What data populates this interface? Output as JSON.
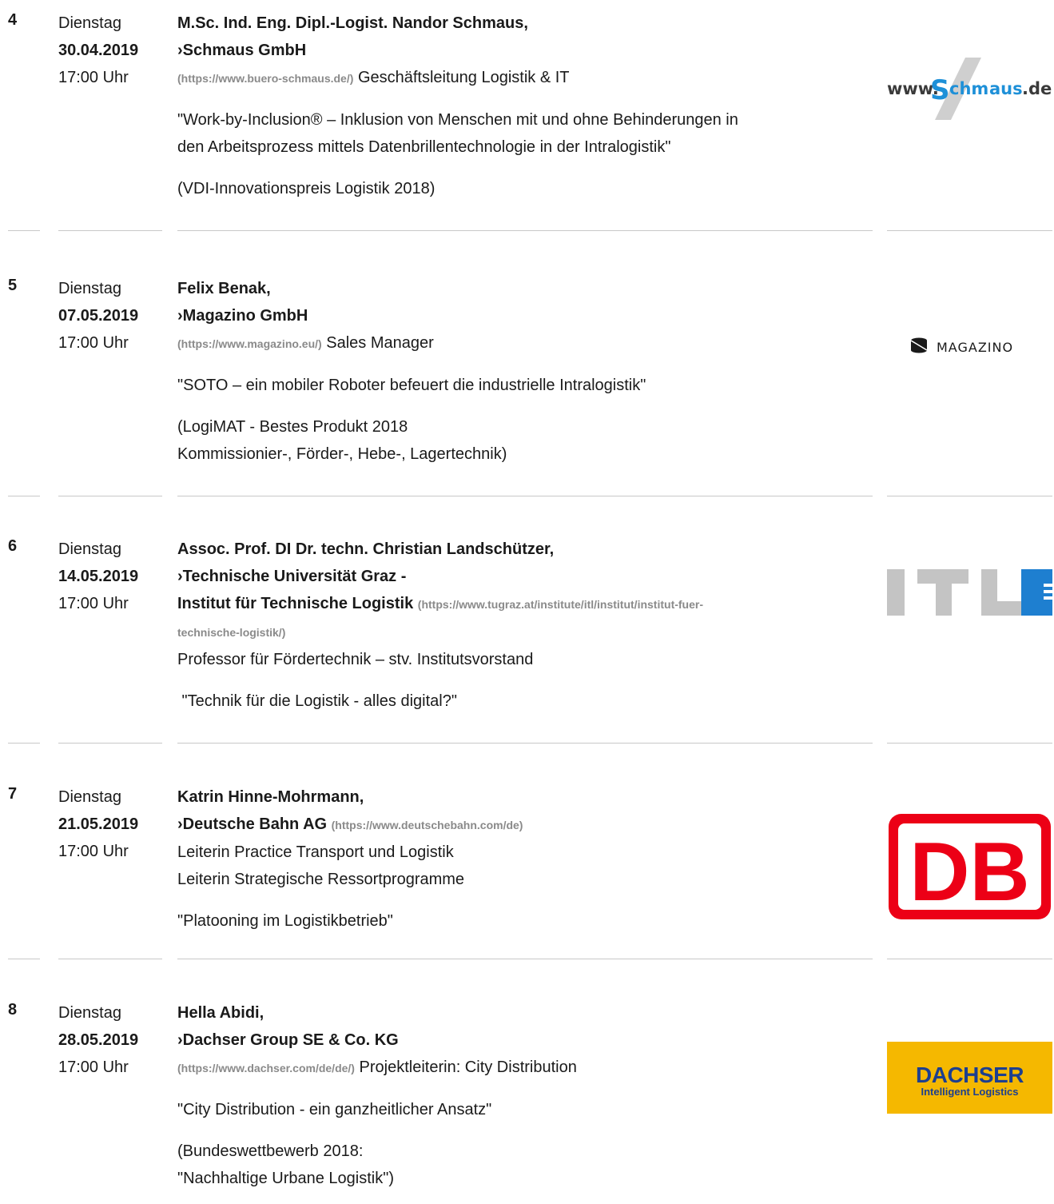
{
  "entries": [
    {
      "num": "4",
      "weekday": "Dienstag",
      "date": "30.04.2019",
      "time": "17:00 Uhr",
      "name": "M.Sc. Ind. Eng. Dipl.-Logist. Nandor Schmaus,",
      "company": "Schmaus GmbH",
      "url": "(https://www.buero-schmaus.de/)",
      "role": "Geschäftsleitung Logistik & IT",
      "talk_line1": "\"Work-by-Inclusion® – Inklusion von Menschen mit und ohne Behinderungen in",
      "talk_line2": "den Arbeitsprozess mittels Datenbrillentechnologie in der Intralogistik\"",
      "note": "(VDI-Innovationspreis Logistik 2018)",
      "logo": {
        "prefix": "www.",
        "S": "S",
        "mid": "chm",
        "a": "a",
        "rest": "us",
        "tld": ".de"
      }
    },
    {
      "num": "5",
      "weekday": "Dienstag",
      "date": "07.05.2019",
      "time": "17:00 Uhr",
      "name": "Felix Benak,",
      "company": "Magazino GmbH",
      "url": "(https://www.magazino.eu/)",
      "role": "Sales Manager",
      "talk": "\"SOTO – ein mobiler Roboter befeuert die industrielle Intralogistik\"",
      "note_line1": "(LogiMAT - Bestes Produkt 2018",
      "note_line2": "Kommissionier-, Förder-, Hebe-, Lagertechnik)",
      "logo": {
        "text": "MAGAZINO"
      }
    },
    {
      "num": "6",
      "weekday": "Dienstag",
      "date": "14.05.2019",
      "time": "17:00 Uhr",
      "name": "Assoc. Prof. DI Dr. techn. Christian Landschützer,",
      "company_line1": "Technische Universität Graz -",
      "company_line2": "Institut für Technische Logistik",
      "url_part1": "(https://www.tugraz.at/institute/itl/institut/institut-fuer-",
      "url_part2": "technische-logistik/)",
      "role": "Professor für Fördertechnik – stv. Institutsvorstand",
      "talk": " \"Technik für die Logistik - alles digital?\"",
      "logo": {
        "text": "ITL"
      }
    },
    {
      "num": "7",
      "weekday": "Dienstag",
      "date": "21.05.2019",
      "time": "17:00 Uhr",
      "name": "Katrin Hinne-Mohrmann,",
      "company": "Deutsche Bahn AG",
      "url": "(https://www.deutschebahn.com/de)",
      "role_line1": "Leiterin Practice Transport und Logistik",
      "role_line2": "Leiterin Strategische Ressortprogramme",
      "talk": "\"Platooning im Logistikbetrieb\"",
      "logo": {
        "text": "DB"
      }
    },
    {
      "num": "8",
      "weekday": "Dienstag",
      "date": "28.05.2019",
      "time": "17:00 Uhr",
      "name": "Hella Abidi,",
      "company": "Dachser Group SE & Co. KG",
      "url": "(https://www.dachser.com/de/de/)",
      "role": "Projektleiterin: City Distribution",
      "talk": "\"City Distribution - ein ganzheitlicher Ansatz\"",
      "note_line1": "(Bundeswettbewerb 2018:",
      "note_line2": "\"Nachhaltige Urbane Logistik\")",
      "logo": {
        "line1": "DACHSER",
        "line2": "Intelligent Logistics"
      }
    }
  ],
  "chevron": "›",
  "colors": {
    "url_gray": "#8a8a8a",
    "separator": "#c8c8c8",
    "schmaus_blue": "#1e90d8",
    "db_red": "#ec0016",
    "dachser_yellow": "#f5b800",
    "dachser_blue": "#1d3f8f",
    "itl_blue": "#1e7fd0"
  }
}
